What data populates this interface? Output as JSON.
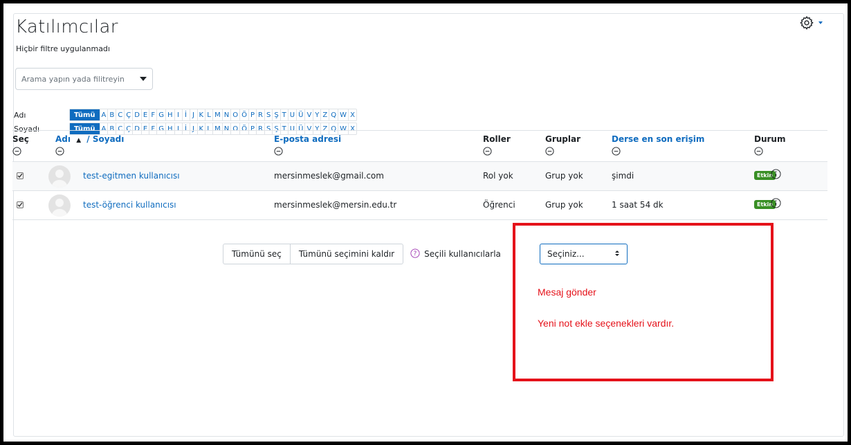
{
  "page": {
    "title": "Katılımcılar",
    "filter_note": "Hiçbir filtre uygulanmadı",
    "search_placeholder": "Arama yapın yada filitreyin",
    "settings_icon": "gear-icon"
  },
  "initials": {
    "first_label": "Adı",
    "last_label": "Soyadı",
    "all_label": "Tümü",
    "letters": [
      "A",
      "B",
      "C",
      "Ç",
      "D",
      "E",
      "F",
      "G",
      "H",
      "I",
      "İ",
      "J",
      "K",
      "L",
      "M",
      "N",
      "O",
      "Ö",
      "P",
      "R",
      "S",
      "Ş",
      "T",
      "U",
      "Ü",
      "V",
      "Y",
      "Z",
      "Q",
      "W",
      "X"
    ]
  },
  "table": {
    "headers": {
      "select": "Seç",
      "first_name": "Adı",
      "last_name": "/ Soyadı",
      "email": "E-posta adresi",
      "roles": "Roller",
      "groups": "Gruplar",
      "last_access": "Derse en son erişim",
      "status": "Durum"
    },
    "rows": [
      {
        "name": "test-egitmen kullanıcısı",
        "email": "mersinmeslek@gmail.com",
        "role": "Rol yok",
        "group": "Grup yok",
        "last_access": "şimdi",
        "status": "Etkin"
      },
      {
        "name": "test-öğrenci kullanıcısı",
        "email": "mersinmeslek@mersin.edu.tr",
        "role": "Öğrenci",
        "group": "Grup yok",
        "last_access": "1 saat 54 dk",
        "status": "Etkin"
      }
    ]
  },
  "actions": {
    "select_all": "Tümünü seç",
    "deselect_all": "Tümünü seçimini kaldır",
    "with_selected": "Seçili kullanıcılarla...",
    "dropdown_value": "Seçiniz..."
  },
  "annotation": {
    "line1": "Mesaj gönder",
    "line2": "Yeni not ekle seçenekleri vardır.",
    "color": "#e5121a"
  },
  "colors": {
    "link": "#0f6cbf",
    "badge": "#398f25"
  }
}
